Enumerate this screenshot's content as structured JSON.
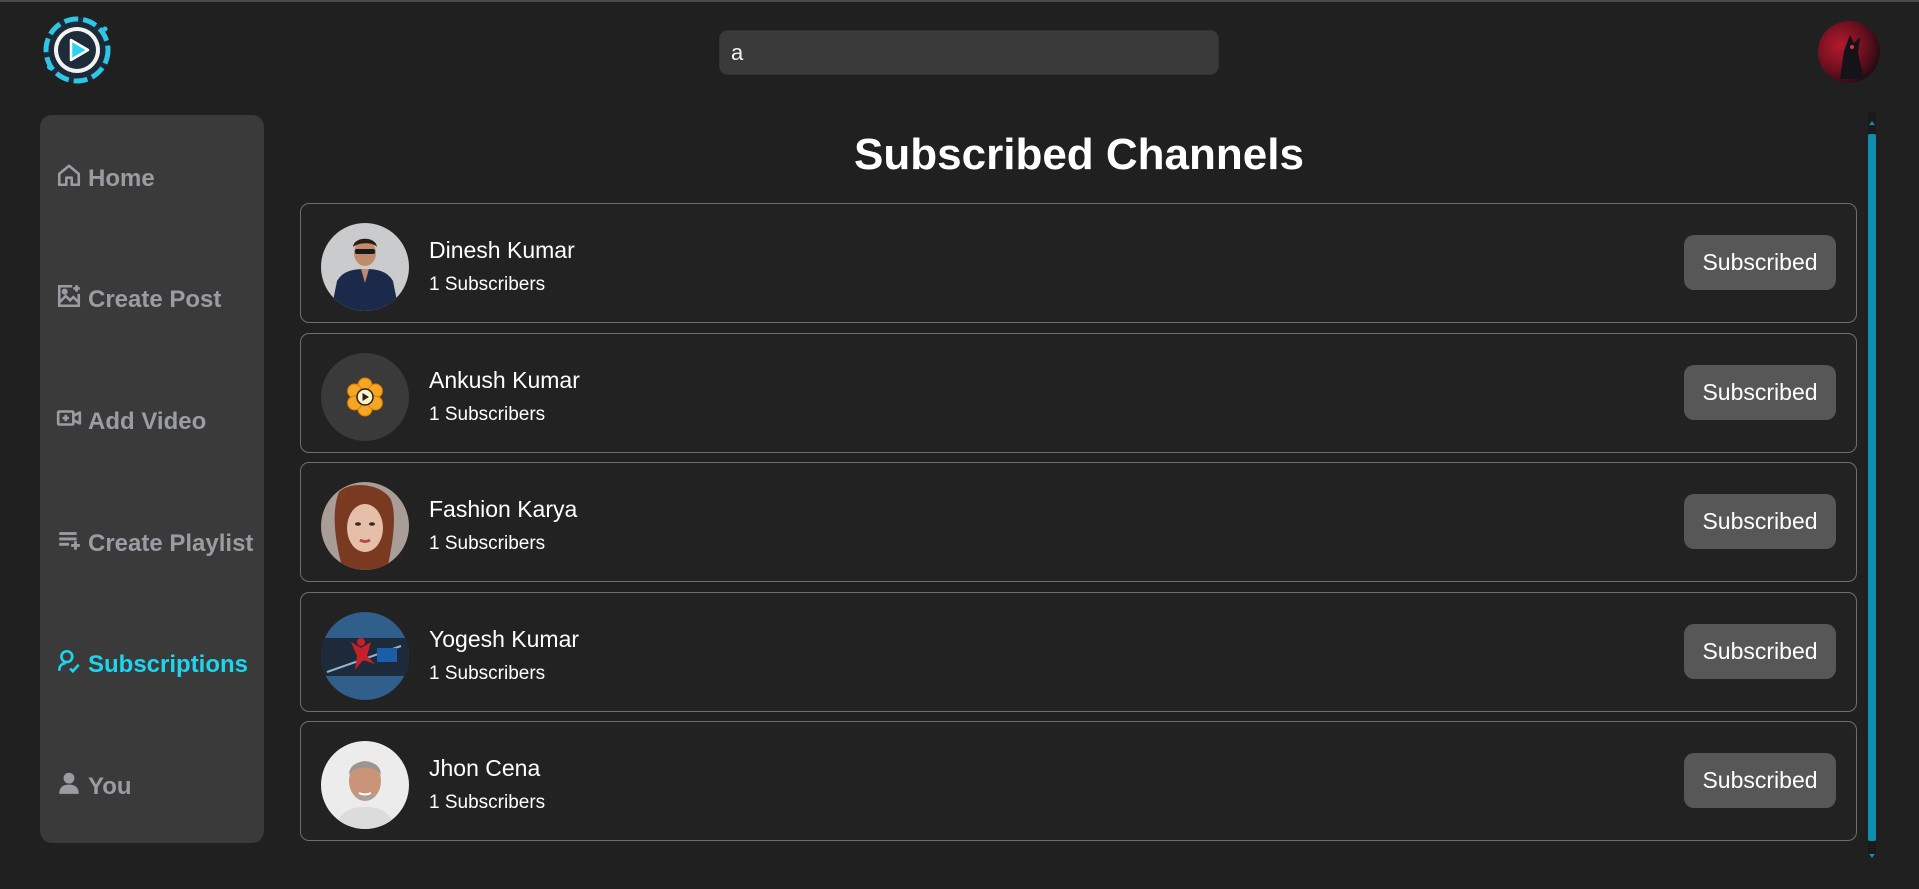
{
  "header": {
    "search_value": "a"
  },
  "sidebar": {
    "items": [
      {
        "label": "Home",
        "icon": "home-icon"
      },
      {
        "label": "Create Post",
        "icon": "image-plus-icon"
      },
      {
        "label": "Add Video",
        "icon": "video-plus-icon"
      },
      {
        "label": "Create Playlist",
        "icon": "playlist-add-icon"
      },
      {
        "label": "Subscriptions",
        "icon": "user-badge-icon",
        "active": true
      },
      {
        "label": "You",
        "icon": "user-icon"
      }
    ]
  },
  "main": {
    "title": "Subscribed Channels",
    "channels": [
      {
        "name": "Dinesh Kumar",
        "subscribers": "1 Subscribers",
        "button": "Subscribed"
      },
      {
        "name": "Ankush Kumar",
        "subscribers": "1 Subscribers",
        "button": "Subscribed"
      },
      {
        "name": "Fashion Karya",
        "subscribers": "1 Subscribers",
        "button": "Subscribed"
      },
      {
        "name": "Yogesh Kumar",
        "subscribers": "1 Subscribers",
        "button": "Subscribed"
      },
      {
        "name": "Jhon Cena",
        "subscribers": "1 Subscribers",
        "button": "Subscribed"
      }
    ]
  },
  "colors": {
    "background": "#202020",
    "sidebar": "#3a3a3b",
    "accent": "#1ed4ee",
    "nav_text": "#9a9ca2",
    "button": "#575757",
    "scroll_thumb": "#0e8fb0"
  }
}
